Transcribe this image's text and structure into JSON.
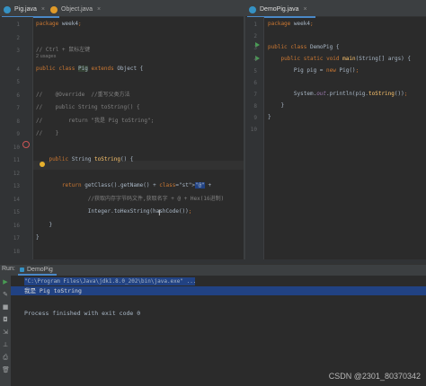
{
  "left_tabs": [
    {
      "label": "Pig.java",
      "active": true,
      "icon": "class-icon"
    },
    {
      "label": "Object.java",
      "active": false,
      "icon": "class-icon"
    }
  ],
  "right_tabs": [
    {
      "label": "DemoPig.java",
      "active": true,
      "icon": "class-icon"
    }
  ],
  "close_glyph": "×",
  "left_code": {
    "line_numbers": [
      "1",
      "2",
      "3",
      "4",
      "5",
      "6",
      "7",
      "8",
      "9",
      "10",
      "11",
      "12",
      "13",
      "14",
      "15",
      "16",
      "17",
      "18"
    ],
    "usages_hint": "2 usages",
    "lines": [
      "package week4;",
      "",
      "// Ctrl + 鼠标左键",
      "public class Pig extends Object {",
      "",
      "//    @Override  //重写父类方法",
      "//    public String toString() {",
      "//        return \"我是 Pig toString\";",
      "//    }",
      "",
      "    public String toString() {",
      "",
      "        return getClass().getName() + \"@\" +",
      "                //获取内存字节码文件,获取名字 + @ + Hex(16进制)",
      "                Integer.toHexString(hashCode());",
      "    }",
      "}",
      ""
    ]
  },
  "right_code": {
    "line_numbers": [
      "1",
      "2",
      "3",
      "4",
      "5",
      "6",
      "7",
      "8",
      "9",
      "10"
    ],
    "lines": [
      "package week4;",
      "",
      "public class DemoPig {",
      "    public static void main(String[] args) {",
      "        Pig pig = new Pig();",
      "",
      "        System.out.println(pig.toString());",
      "    }",
      "}",
      ""
    ]
  },
  "run_panel": {
    "label": "Run:",
    "tab": "DemoPig",
    "command": "\"C:\\Program Files\\Java\\jdk1.8.0_202\\bin\\java.exe\" ...",
    "output_line": "我是 Pig toString",
    "exit_line": "Process finished with exit code 0"
  },
  "watermark": "CSDN @2301_80370342",
  "colors": {
    "editor_bg": "#2b2b2b",
    "keyword": "#cc7832",
    "comment": "#808080",
    "string": "#6a8759",
    "method": "#ffc66d",
    "selection": "#214283",
    "run_green": "#499c54"
  }
}
